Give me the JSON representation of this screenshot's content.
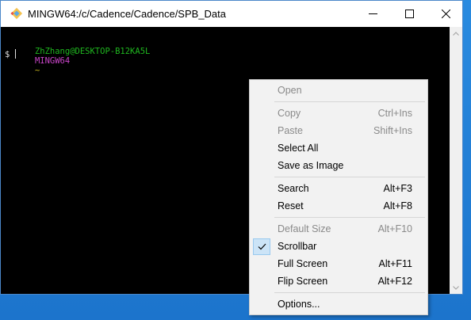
{
  "window": {
    "title": "MINGW64:/c/Cadence/Cadence/SPB_Data",
    "controls": [
      "minimize-icon",
      "maximize-icon",
      "close-icon"
    ]
  },
  "terminal": {
    "prompt_user": "ZhZhang@DESKTOP-B12KA5L",
    "prompt_env": "MINGW64",
    "prompt_path": "~",
    "prompt_symbol": "$",
    "colors": {
      "user": "#1fb61f",
      "env": "#c844c8",
      "path": "#c8b51f",
      "text": "#e0e0e0"
    }
  },
  "context_menu": {
    "items": [
      {
        "label": "Open",
        "accel": "",
        "disabled": true
      },
      {
        "label": "Copy",
        "accel": "Ctrl+Ins",
        "disabled": true
      },
      {
        "label": "Paste",
        "accel": "Shift+Ins",
        "disabled": true
      },
      {
        "label": "Select All",
        "accel": "",
        "disabled": false
      },
      {
        "label": "Save as Image",
        "accel": "",
        "disabled": false
      },
      {
        "label": "Search",
        "accel": "Alt+F3",
        "disabled": false
      },
      {
        "label": "Reset",
        "accel": "Alt+F8",
        "disabled": false
      },
      {
        "label": "Default Size",
        "accel": "Alt+F10",
        "disabled": true
      },
      {
        "label": "Scrollbar",
        "accel": "",
        "disabled": false,
        "checked": true
      },
      {
        "label": "Full Screen",
        "accel": "Alt+F11",
        "disabled": false
      },
      {
        "label": "Flip Screen",
        "accel": "Alt+F12",
        "disabled": false
      },
      {
        "label": "Options...",
        "accel": "",
        "disabled": false
      }
    ]
  }
}
